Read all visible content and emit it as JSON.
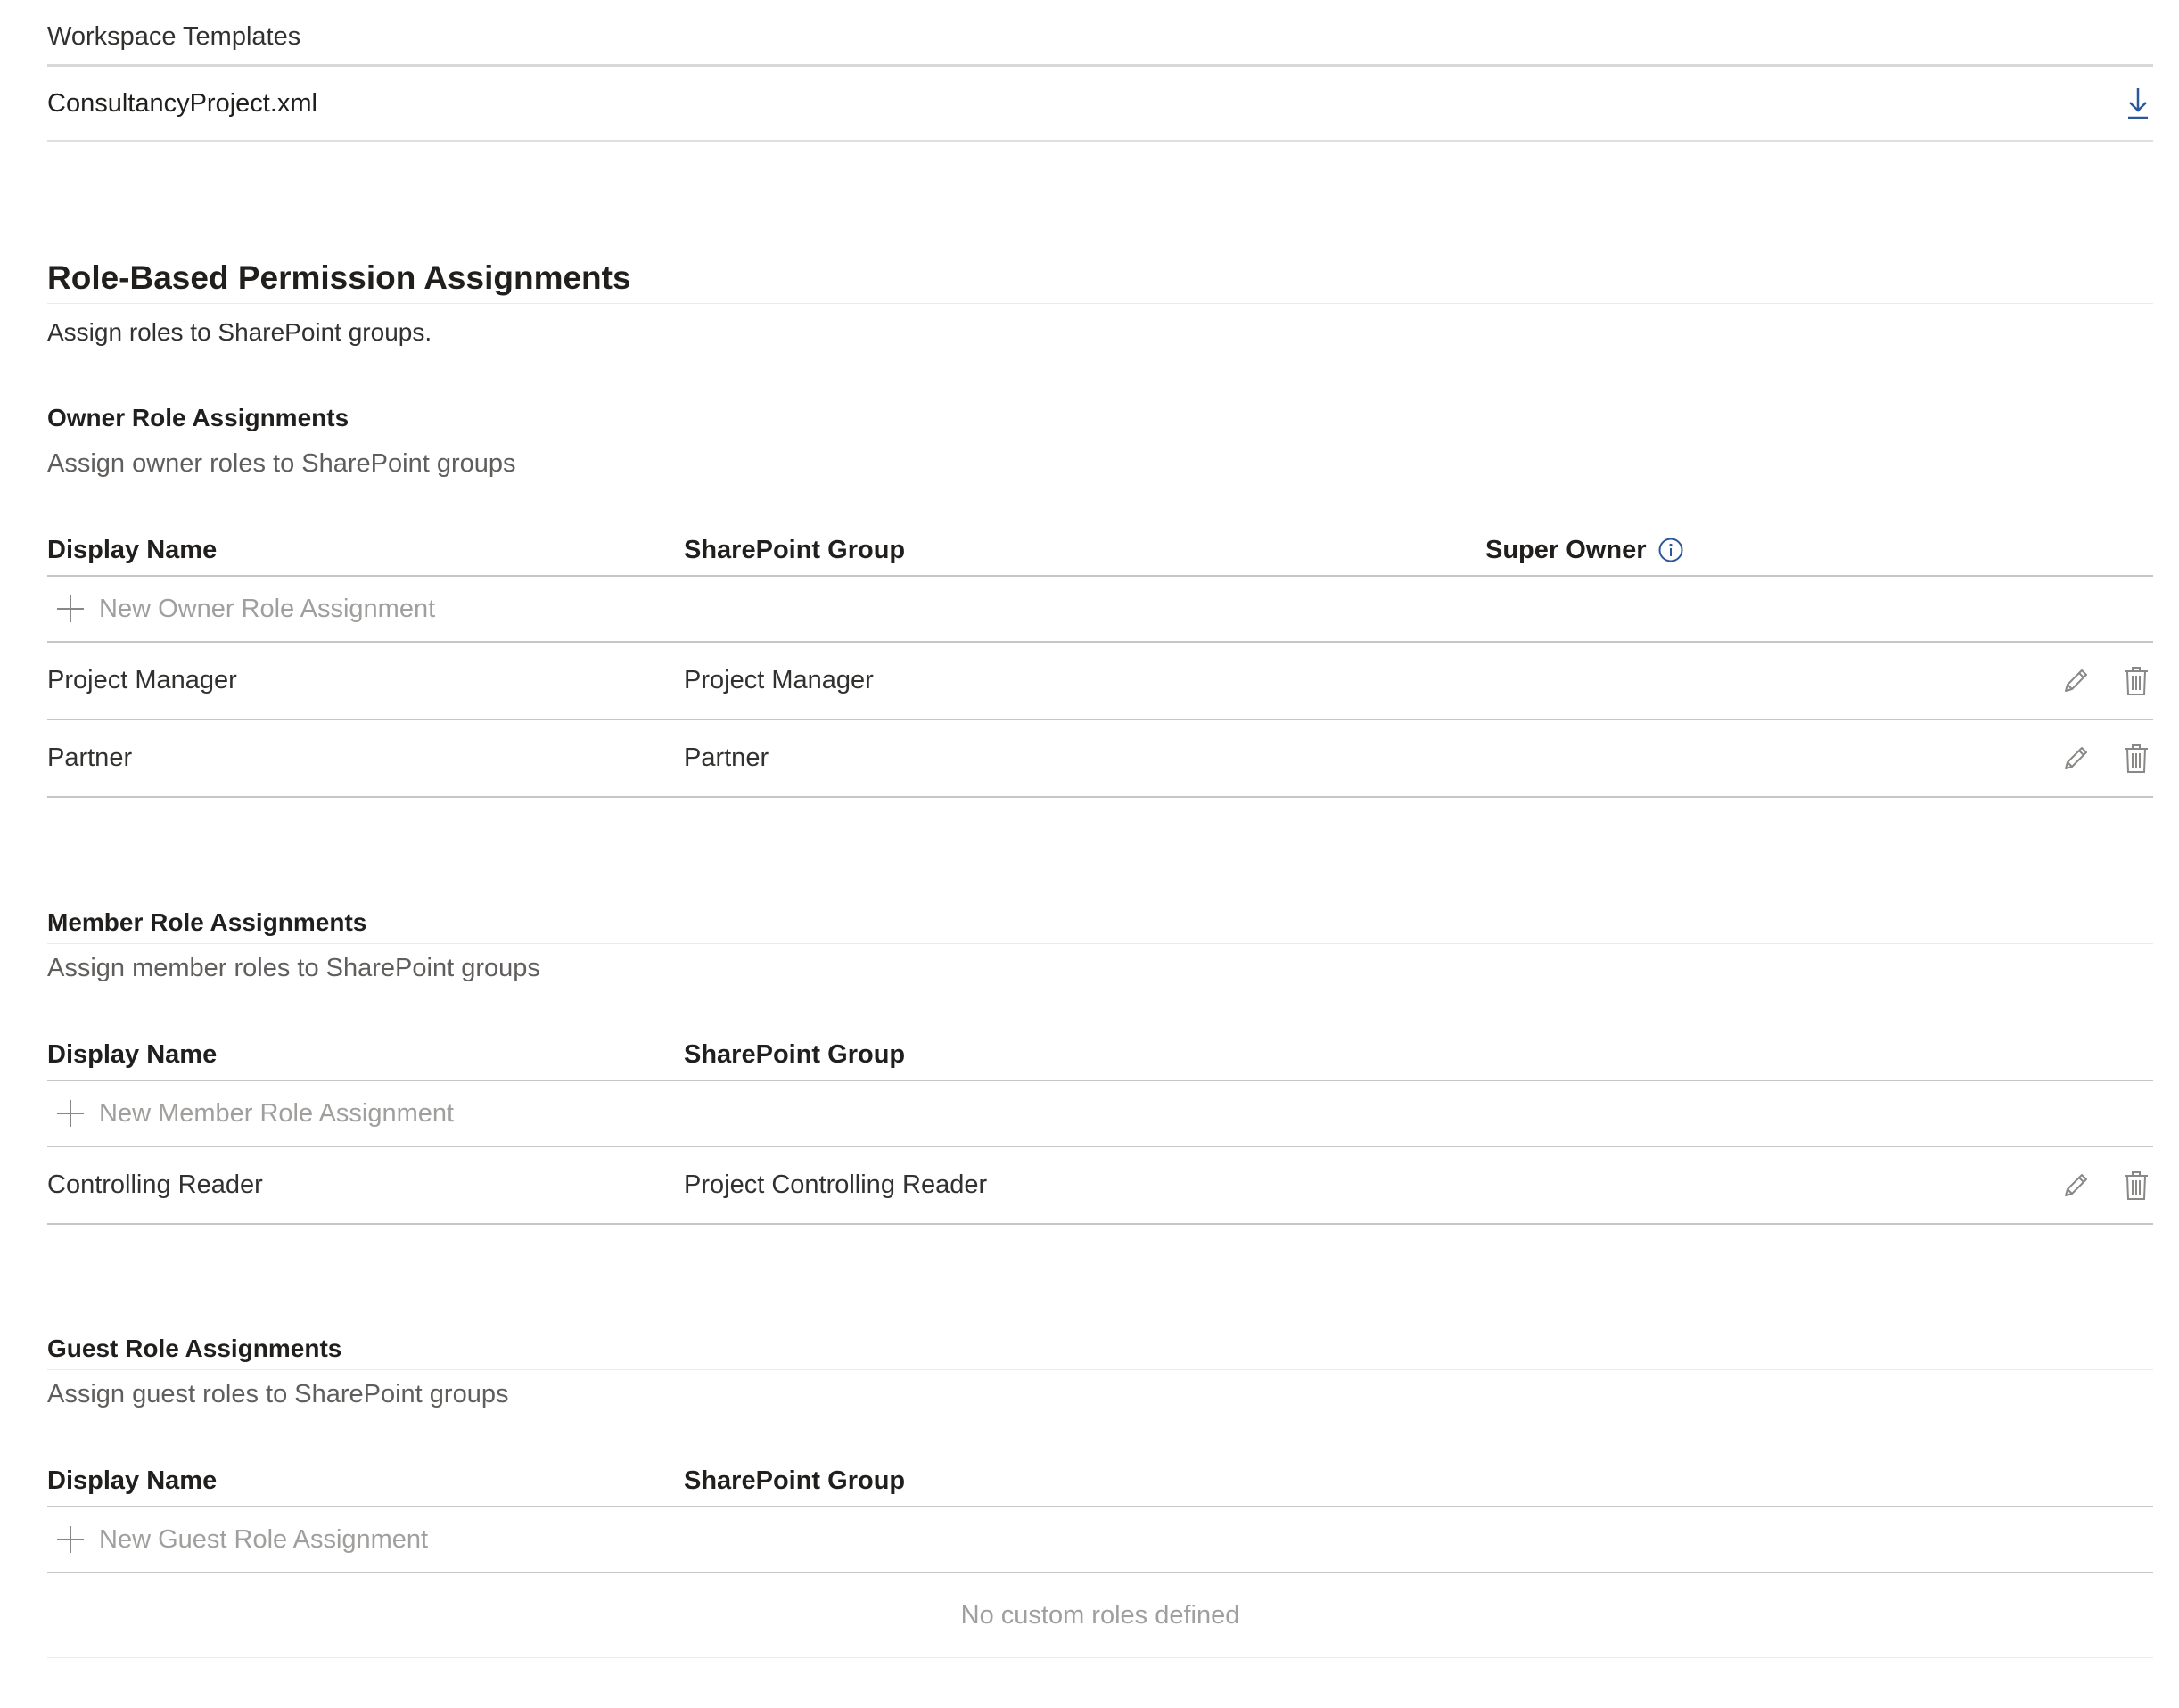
{
  "workspace_templates": {
    "title": "Workspace Templates",
    "file_name": "ConsultancyProject.xml",
    "download_icon": "download-icon"
  },
  "rbpa": {
    "title": "Role-Based Permission Assignments",
    "subtitle": "Assign roles to SharePoint groups."
  },
  "owner": {
    "title": "Owner Role Assignments",
    "subtitle": "Assign owner roles to SharePoint groups",
    "columns": {
      "display_name": "Display Name",
      "sharepoint_group": "SharePoint Group",
      "super_owner": "Super Owner"
    },
    "new_label": "New Owner Role Assignment",
    "rows": [
      {
        "display_name": "Project Manager",
        "group": "Project Manager"
      },
      {
        "display_name": "Partner",
        "group": "Partner"
      }
    ]
  },
  "member": {
    "title": "Member Role Assignments",
    "subtitle": "Assign member roles to SharePoint groups",
    "columns": {
      "display_name": "Display Name",
      "sharepoint_group": "SharePoint Group"
    },
    "new_label": "New Member Role Assignment",
    "rows": [
      {
        "display_name": "Controlling Reader",
        "group": "Project Controlling Reader"
      }
    ]
  },
  "guest": {
    "title": "Guest Role Assignments",
    "subtitle": "Assign guest roles to SharePoint groups",
    "columns": {
      "display_name": "Display Name",
      "sharepoint_group": "SharePoint Group"
    },
    "new_label": "New Guest Role Assignment",
    "empty_text": "No custom roles defined"
  },
  "colors": {
    "accent": "#2b579a",
    "icon_gray": "#8a8886",
    "placeholder": "#a19f9d"
  }
}
